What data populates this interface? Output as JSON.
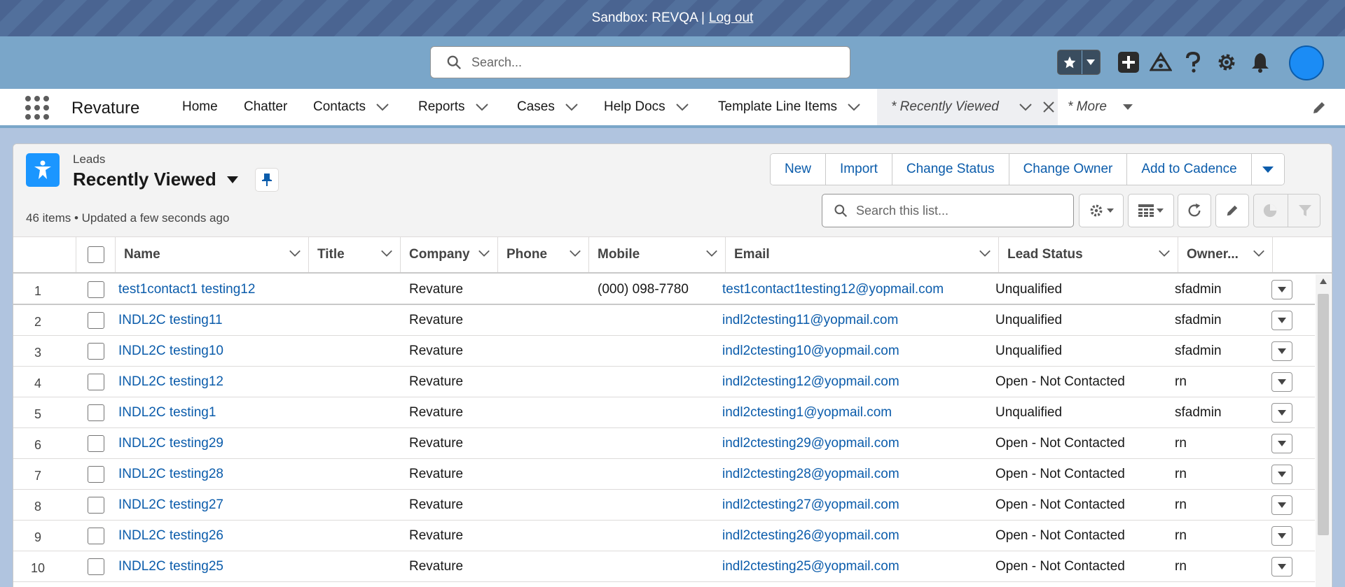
{
  "banner": {
    "text": "Sandbox: REVQA |",
    "logout": "Log out"
  },
  "header": {
    "search_placeholder": "Search...",
    "icons": [
      "star-icon",
      "chevron-down-icon",
      "add-icon",
      "trailhead-icon",
      "help-icon",
      "setup-gear-icon",
      "bell-icon",
      "avatar"
    ]
  },
  "nav": {
    "app_name": "Revature",
    "items": [
      {
        "label": "Home"
      },
      {
        "label": "Chatter"
      },
      {
        "label": "Contacts"
      },
      {
        "label": "Reports"
      },
      {
        "label": "Cases"
      },
      {
        "label": "Help Docs"
      },
      {
        "label": "Template Line Items"
      }
    ],
    "active_tab": "* Recently Viewed",
    "more": "* More"
  },
  "list": {
    "object_label": "Leads",
    "view_name": "Recently Viewed",
    "meta": "46 items • Updated a few seconds ago",
    "search_placeholder": "Search this list...",
    "buttons": [
      "New",
      "Import",
      "Change Status",
      "Change Owner",
      "Add to Cadence"
    ]
  },
  "table": {
    "columns": [
      "Name",
      "Title",
      "Company",
      "Phone",
      "Mobile",
      "Email",
      "Lead Status",
      "Owner..."
    ],
    "rows": [
      {
        "num": "1",
        "name": "test1contact1 testing12",
        "title": "",
        "company": "Revature",
        "phone": "",
        "mobile": "(000) 098-7780",
        "email": "test1contact1testing12@yopmail.com",
        "status": "Unqualified",
        "owner": "sfadmin"
      },
      {
        "num": "2",
        "name": "INDL2C testing11",
        "title": "",
        "company": "Revature",
        "phone": "",
        "mobile": "",
        "email": "indl2ctesting11@yopmail.com",
        "status": "Unqualified",
        "owner": "sfadmin"
      },
      {
        "num": "3",
        "name": "INDL2C testing10",
        "title": "",
        "company": "Revature",
        "phone": "",
        "mobile": "",
        "email": "indl2ctesting10@yopmail.com",
        "status": "Unqualified",
        "owner": "sfadmin"
      },
      {
        "num": "4",
        "name": "INDL2C testing12",
        "title": "",
        "company": "Revature",
        "phone": "",
        "mobile": "",
        "email": "indl2ctesting12@yopmail.com",
        "status": "Open - Not Contacted",
        "owner": "rn"
      },
      {
        "num": "5",
        "name": "INDL2C testing1",
        "title": "",
        "company": "Revature",
        "phone": "",
        "mobile": "",
        "email": "indl2ctesting1@yopmail.com",
        "status": "Unqualified",
        "owner": "sfadmin"
      },
      {
        "num": "6",
        "name": "INDL2C testing29",
        "title": "",
        "company": "Revature",
        "phone": "",
        "mobile": "",
        "email": "indl2ctesting29@yopmail.com",
        "status": "Open - Not Contacted",
        "owner": "rn"
      },
      {
        "num": "7",
        "name": "INDL2C testing28",
        "title": "",
        "company": "Revature",
        "phone": "",
        "mobile": "",
        "email": "indl2ctesting28@yopmail.com",
        "status": "Open - Not Contacted",
        "owner": "rn"
      },
      {
        "num": "8",
        "name": "INDL2C testing27",
        "title": "",
        "company": "Revature",
        "phone": "",
        "mobile": "",
        "email": "indl2ctesting27@yopmail.com",
        "status": "Open - Not Contacted",
        "owner": "rn"
      },
      {
        "num": "9",
        "name": "INDL2C testing26",
        "title": "",
        "company": "Revature",
        "phone": "",
        "mobile": "",
        "email": "indl2ctesting26@yopmail.com",
        "status": "Open - Not Contacted",
        "owner": "rn"
      },
      {
        "num": "10",
        "name": "INDL2C testing25",
        "title": "",
        "company": "Revature",
        "phone": "",
        "mobile": "",
        "email": "indl2ctesting25@yopmail.com",
        "status": "Open - Not Contacted",
        "owner": "rn"
      }
    ]
  },
  "colors": {
    "brand_blue": "#0b5cab",
    "header_bg": "#7aa6c9",
    "leads_icon": "#1b96ff"
  }
}
